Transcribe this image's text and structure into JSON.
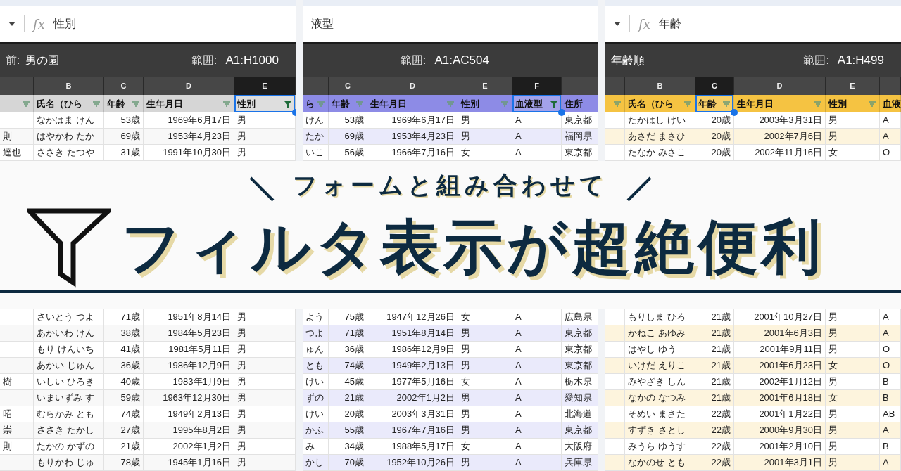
{
  "panels": [
    {
      "color": "#d6d6d6",
      "formula": {
        "function_label": "fx",
        "value": "性別"
      },
      "filter_bar": {
        "name_label": "前:",
        "name": "男の園",
        "range_label": "範囲:",
        "range": "A1:H1000"
      },
      "columns": [
        {
          "kind": "text",
          "filter_active": false,
          "selected": false
        },
        {
          "letter": "B",
          "header": "氏名（ひら",
          "kind": "text",
          "filter_active": false,
          "selected": false
        },
        {
          "letter": "C",
          "header": "年齢",
          "kind": "number",
          "filter_active": false,
          "selected": false
        },
        {
          "letter": "D",
          "header": "生年月日",
          "kind": "number",
          "filter_active": false,
          "selected": false
        },
        {
          "letter": "E",
          "header": "性別",
          "kind": "text",
          "filter_active": true,
          "selected": true
        }
      ],
      "top_rows": [
        [
          null,
          "なかはま けん",
          "53歳",
          "1969年6月17日",
          "男"
        ],
        [
          "則",
          "はやかわ たか",
          "69歳",
          "1953年4月23日",
          "男"
        ],
        [
          "達也",
          "ささき たつや",
          "31歳",
          "1991年10月30日",
          "男"
        ]
      ],
      "bottom_rows": [
        [
          null,
          "さいとう つよ",
          "71歳",
          "1951年8月14日",
          "男"
        ],
        [
          null,
          "あかいわ けん",
          "38歳",
          "1984年5月23日",
          "男"
        ],
        [
          null,
          "もり けんいち",
          "41歳",
          "1981年5月11日",
          "男"
        ],
        [
          null,
          "あかい じゅん",
          "36歳",
          "1986年12月9日",
          "男"
        ],
        [
          "樹",
          "いしい ひろき",
          "40歳",
          "1983年1月9日",
          "男"
        ],
        [
          null,
          "いまいずみ す",
          "59歳",
          "1963年12月30日",
          "男"
        ],
        [
          "昭",
          "むらかみ とも",
          "74歳",
          "1949年2月13日",
          "男"
        ],
        [
          "崇",
          "ささき たかし",
          "27歳",
          "1995年8月2日",
          "男"
        ],
        [
          "則",
          "たかの かずの",
          "21歳",
          "2002年1月2日",
          "男"
        ],
        [
          null,
          "もりかわ じゅ",
          "78歳",
          "1945年1月16日",
          "男"
        ]
      ]
    },
    {
      "color": "#8d8be6",
      "formula": {
        "value": "液型"
      },
      "filter_bar": {
        "range_label": "範囲:",
        "range": "A1:AC504"
      },
      "columns": [
        {
          "header": "ら",
          "kind": "text",
          "filter_active": false,
          "selected": false
        },
        {
          "letter": "C",
          "header": "年齢",
          "kind": "number",
          "filter_active": false,
          "selected": false
        },
        {
          "letter": "D",
          "header": "生年月日",
          "kind": "number",
          "filter_active": false,
          "selected": false
        },
        {
          "letter": "E",
          "header": "性別",
          "kind": "text",
          "filter_active": false,
          "selected": false
        },
        {
          "letter": "F",
          "header": "血液型",
          "kind": "text",
          "filter_active": true,
          "selected": true
        },
        {
          "header": "住所",
          "kind": "text",
          "selected": false
        }
      ],
      "top_rows": [
        [
          "けん",
          "53歳",
          "1969年6月17日",
          "男",
          "A",
          "東京都"
        ],
        [
          "たか",
          "69歳",
          "1953年4月23日",
          "男",
          "A",
          "福岡県"
        ],
        [
          "いこ",
          "56歳",
          "1966年7月16日",
          "女",
          "A",
          "東京都"
        ]
      ],
      "bottom_rows": [
        [
          "よう",
          "75歳",
          "1947年12月26日",
          "女",
          "A",
          "広島県"
        ],
        [
          "つよ",
          "71歳",
          "1951年8月14日",
          "男",
          "A",
          "東京都"
        ],
        [
          "ゅん",
          "36歳",
          "1986年12月9日",
          "男",
          "A",
          "東京都"
        ],
        [
          "とも",
          "74歳",
          "1949年2月13日",
          "男",
          "A",
          "東京都"
        ],
        [
          "けい",
          "45歳",
          "1977年5月16日",
          "女",
          "A",
          "栃木県"
        ],
        [
          "ずの",
          "21歳",
          "2002年1月2日",
          "男",
          "A",
          "愛知県"
        ],
        [
          "けい",
          "20歳",
          "2003年3月31日",
          "男",
          "A",
          "北海道"
        ],
        [
          "かふ",
          "55歳",
          "1967年7月16日",
          "男",
          "A",
          "東京都"
        ],
        [
          "み",
          "34歳",
          "1988年5月17日",
          "女",
          "A",
          "大阪府"
        ],
        [
          "かし",
          "70歳",
          "1952年10月26日",
          "男",
          "A",
          "兵庫県"
        ]
      ]
    },
    {
      "color": "#f5c342",
      "formula": {
        "function_label": "fx",
        "value": "年齢"
      },
      "filter_bar": {
        "name": "年齢順",
        "range_label": "範囲:",
        "range": "A1:H499"
      },
      "columns": [
        {
          "kind": "text",
          "filter_active": false,
          "selected": false
        },
        {
          "letter": "B",
          "header": "氏名（ひら",
          "kind": "text",
          "filter_active": false,
          "selected": false
        },
        {
          "letter": "C",
          "header": "年齢",
          "kind": "number",
          "filter_active": false,
          "selected": true
        },
        {
          "letter": "D",
          "header": "生年月日",
          "kind": "number",
          "filter_active": false,
          "selected": false
        },
        {
          "letter": "E",
          "header": "性別",
          "kind": "text",
          "filter_active": false,
          "selected": false
        },
        {
          "header": "血液",
          "kind": "text",
          "selected": false
        }
      ],
      "top_rows": [
        [
          null,
          "たかはし けい",
          "20歳",
          "2003年3月31日",
          "男",
          "A"
        ],
        [
          null,
          "あさだ まさひ",
          "20歳",
          "2002年7月6日",
          "男",
          "A"
        ],
        [
          null,
          "たなか みさこ",
          "20歳",
          "2002年11月16日",
          "女",
          "O"
        ]
      ],
      "bottom_rows": [
        [
          null,
          "もりしま ひろ",
          "21歳",
          "2001年10月27日",
          "男",
          "A"
        ],
        [
          null,
          "かねこ あゆみ",
          "21歳",
          "2001年6月3日",
          "男",
          "A"
        ],
        [
          null,
          "はやし ゆう",
          "21歳",
          "2001年9月11日",
          "男",
          "O"
        ],
        [
          null,
          "いけだ えりこ",
          "21歳",
          "2001年6月23日",
          "女",
          "O"
        ],
        [
          null,
          "みやざき しん",
          "21歳",
          "2002年1月12日",
          "男",
          "B"
        ],
        [
          null,
          "なかの なつみ",
          "21歳",
          "2001年6月18日",
          "女",
          "B"
        ],
        [
          null,
          "そめい まさた",
          "22歳",
          "2001年1月22日",
          "男",
          "AB"
        ],
        [
          null,
          "すずき さとし",
          "22歳",
          "2000年9月30日",
          "男",
          "A"
        ],
        [
          null,
          "みうら ゆうす",
          "22歳",
          "2001年2月10日",
          "男",
          "B"
        ],
        [
          null,
          "なかのせ とも",
          "22歳",
          "2001年3月1日",
          "男",
          "A"
        ]
      ]
    }
  ],
  "title": {
    "lead": "フォームと組み合わせて",
    "main": "フィルタ表示が超絶便利"
  }
}
